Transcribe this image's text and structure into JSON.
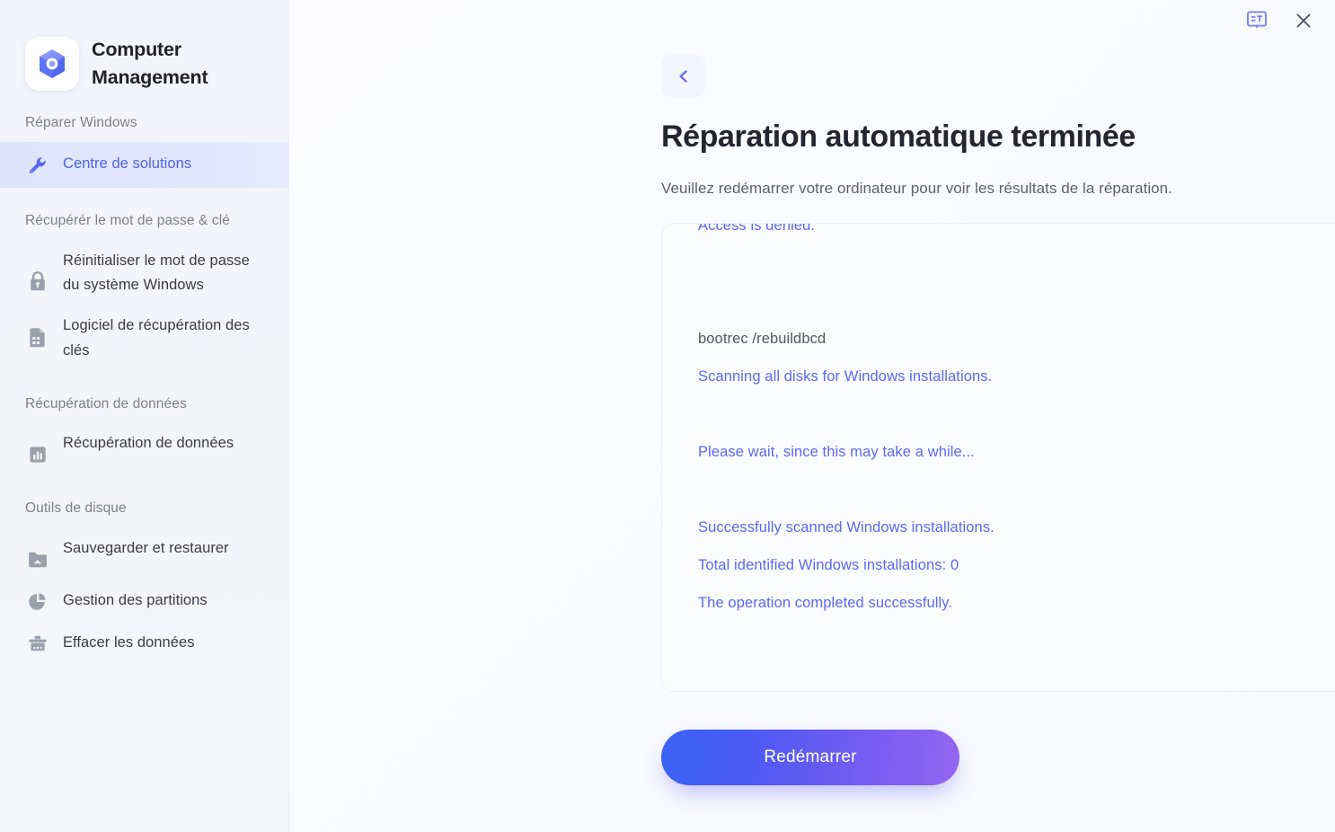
{
  "app": {
    "title": "Computer\nManagement",
    "title_line1": "Computer",
    "title_line2": "Management",
    "logo_icon": "hex-cube-logo-icon"
  },
  "titlebar": {
    "feedback_icon": "feedback-bubble-icon",
    "close_icon": "close-icon"
  },
  "sidebar": {
    "groups": [
      {
        "label": "Réparer Windows",
        "items": [
          {
            "label": "Centre de solutions",
            "icon": "wrench-icon",
            "active": true
          }
        ]
      },
      {
        "label": "Récupérér le mot de passe  & clé",
        "items": [
          {
            "label": "Réinitialiser le mot de passe du système Windows",
            "icon": "lock-icon",
            "active": false
          },
          {
            "label": "Logiciel de récupération des clés",
            "icon": "document-key-icon",
            "active": false
          }
        ]
      },
      {
        "label": "Récupération de données",
        "items": [
          {
            "label": "Récupération de données",
            "icon": "bar-chart-icon",
            "active": false
          }
        ]
      },
      {
        "label": "Outils de disque",
        "items": [
          {
            "label": "Sauvegarder et restaurer",
            "icon": "folder-backup-icon",
            "active": false
          },
          {
            "label": "Gestion des partitions",
            "icon": "pie-chart-icon",
            "active": false
          },
          {
            "label": "Effacer les données",
            "icon": "eraser-icon",
            "active": false
          }
        ]
      }
    ]
  },
  "main": {
    "back_icon": "chevron-left-icon",
    "title": "Réparation automatique terminée",
    "subtitle": "Veuillez redémarrer votre ordinateur pour voir les résultats de la réparation.",
    "log": {
      "lines": [
        {
          "text": "Access is denied.",
          "kind": "output",
          "clipped": true
        },
        {
          "text": "",
          "kind": "blank"
        },
        {
          "text": "",
          "kind": "blank"
        },
        {
          "text": "bootrec /rebuildbcd",
          "kind": "command"
        },
        {
          "text": "Scanning all disks for Windows installations.",
          "kind": "output"
        },
        {
          "text": "",
          "kind": "blank"
        },
        {
          "text": "Please wait, since this may take a while...",
          "kind": "output"
        },
        {
          "text": "",
          "kind": "blank"
        },
        {
          "text": "Successfully scanned Windows installations.",
          "kind": "output"
        },
        {
          "text": "Total identified Windows installations: 0",
          "kind": "output"
        },
        {
          "text": "The operation completed successfully.",
          "kind": "output"
        }
      ]
    },
    "restart_button": "Redémarrer"
  },
  "colors": {
    "accent_blue": "#5b6af0",
    "accent_purple": "#9466f2",
    "sidebar_bg": "#f4f5fa",
    "active_item_bg": "#e1e6fc",
    "panel_bg": "#fafbfd",
    "text_dark": "#23252f",
    "text_muted": "#7c8090"
  }
}
